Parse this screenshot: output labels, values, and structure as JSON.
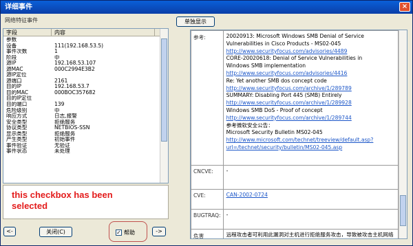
{
  "window": {
    "title": "详细事件",
    "close_glyph": "×"
  },
  "left": {
    "title": "网络特征事件",
    "headers": [
      "字段",
      "内容"
    ],
    "rows": [
      [
        "参数",
        ""
      ],
      [
        "设备",
        "111(192.168.53.5)"
      ],
      [
        "事件次数",
        "1"
      ],
      [
        "阶段",
        "中"
      ],
      [
        "源IP",
        "192.168.53.107"
      ],
      [
        "源MAC",
        "000C2994E3B2"
      ],
      [
        "源IP定位",
        ""
      ],
      [
        "源端口",
        "2161"
      ],
      [
        "目的IP",
        "192.168.53.7"
      ],
      [
        "目的MAC",
        "000BOC357682"
      ],
      [
        "目的IP定位",
        ""
      ],
      [
        "目的端口",
        "139"
      ],
      [
        "危险级别",
        "中"
      ],
      [
        "响应方式",
        "日志,报警"
      ],
      [
        "安全类型",
        "拒绝服务"
      ],
      [
        "协议类型",
        "NETBIOS-SSN"
      ],
      [
        "显示类型",
        "拒绝服务"
      ],
      [
        "产生类型",
        "初始事件"
      ],
      [
        "事件验证",
        "无验证"
      ],
      [
        "事件状态",
        "未处理"
      ]
    ]
  },
  "annotation": {
    "line1": "this checkbox has been",
    "line2": "selected"
  },
  "buttons": {
    "single_display": "单独显示",
    "prev": "<-",
    "close": "关闭(C)",
    "next": "->",
    "help_label": "帮助",
    "help_checked": "✓"
  },
  "detail": {
    "ref_label": "参考:",
    "ref_lines": [
      {
        "t": "20020913: Microsoft Windows SMB Denial of Service",
        "link": false
      },
      {
        "t": "Vulnerabilities in Cisco Products - MS02-045",
        "link": false
      },
      {
        "t": "http://www.securityfocus.com/advisories/4489",
        "link": true
      },
      {
        "t": "CORE-20020618: Denial of Service Vulnerabilities in",
        "link": false
      },
      {
        "t": "Windows SMB implementation",
        "link": false
      },
      {
        "t": "http://www.securityfocus.com/advisories/4416",
        "link": true
      },
      {
        "t": "Re: Yet another SMB dos concept code",
        "link": false
      },
      {
        "t": "http://www.securityfocus.com/archive/1/289789",
        "link": true
      },
      {
        "t": "SUMMARY: Disabling Port 445 (SMB) Entirely",
        "link": false
      },
      {
        "t": "http://www.securityfocus.com/archive/1/289928",
        "link": true
      },
      {
        "t": "Windows SMB DoS - Proof of concept",
        "link": false
      },
      {
        "t": "http://www.securityfocus.com/archive/1/289744",
        "link": true
      },
      {
        "t": "参考微软安全公告：",
        "link": false
      },
      {
        "t": "Microsoft Security Bulletin MS02-045",
        "link": false
      },
      {
        "t": "http://www.microsoft.com/technet/treeview/default.asp?",
        "link": true
      },
      {
        "t": "url=/technet/security/bulletin/MS02-045.asp",
        "link": true
      }
    ],
    "cncve_label": "CNCVE:",
    "cncve_value": "-",
    "cve_label": "CVE:",
    "cve_value": "CAN-2002-0724",
    "bugtraq_label": "BUGTRAQ:",
    "bugtraq_value": "-",
    "harm_label": "危害",
    "harm_value": "远程攻击者可利用此漏洞对主机进行拒绝服务攻击，导致被攻击主机网络连接不正常或崩溃。"
  }
}
